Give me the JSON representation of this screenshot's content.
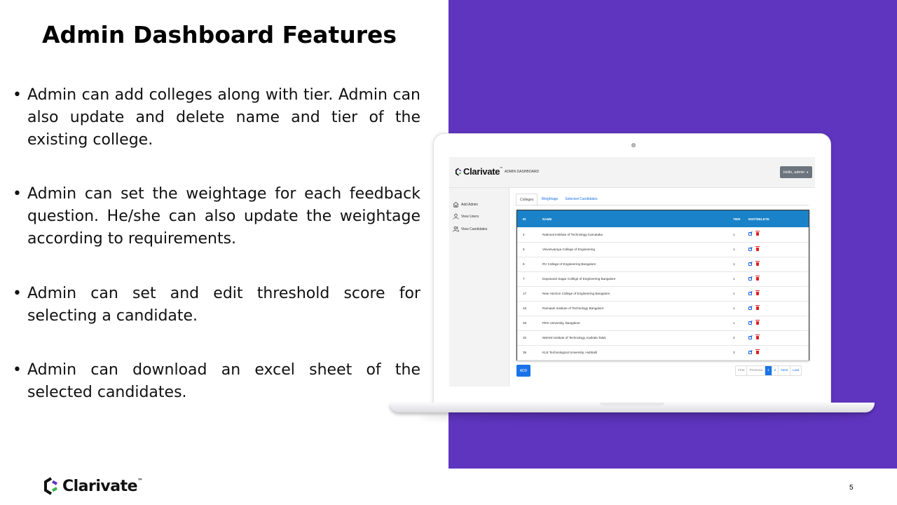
{
  "slide": {
    "title": "Admin Dashboard Features",
    "bullets": [
      "Admin can add colleges along with tier. Admin can also update and delete name and tier of the existing college.",
      "Admin can set the weightage for each feedback question. He/she can also update the weightage according to requirements.",
      "Admin can set and edit threshold score for selecting a candidate.",
      "Admin can download an excel sheet of the selected candidates."
    ],
    "page_number": "5",
    "footer_brand": "Clarivate",
    "footer_tm": "™",
    "accent_color": "#5f35c0"
  },
  "app": {
    "brand": "Clarivate",
    "brand_tm": "™",
    "nav_title": "ADMIN DASHBOARD",
    "user_button": "Hello, admin",
    "sidebar": [
      {
        "label": "Add Admin",
        "icon": "home-icon"
      },
      {
        "label": "View Users",
        "icon": "user-icon"
      },
      {
        "label": "View Candidates",
        "icon": "users-icon"
      }
    ],
    "tabs": [
      {
        "label": "Colleges",
        "active": true
      },
      {
        "label": "Weightage",
        "active": false
      },
      {
        "label": "Selected Candidates",
        "active": false
      }
    ],
    "table": {
      "headers": [
        "ID",
        "NAME",
        "TIER",
        "EDIT/DELETE"
      ],
      "rows": [
        {
          "id": "4",
          "name": "National Institute of Technology Karnataka",
          "tier": "1"
        },
        {
          "id": "5",
          "name": "Visvesvaraya College of Engineering",
          "tier": "1"
        },
        {
          "id": "6",
          "name": "RV College of Engineering Bangalore",
          "tier": "1"
        },
        {
          "id": "7",
          "name": "Dayanand Sagar College of Engineering Bangalore",
          "tier": "1"
        },
        {
          "id": "17",
          "name": "New Horizon College of Engineering Bangalore",
          "tier": "1"
        },
        {
          "id": "19",
          "name": "Ramaiah Institute of Technology Bangalore",
          "tier": "1"
        },
        {
          "id": "28",
          "name": "PES University, Bangalore",
          "tier": "1"
        },
        {
          "id": "32",
          "name": "NMAM Institute of Technology, Karkala Taluk",
          "tier": "2"
        },
        {
          "id": "35",
          "name": "KLE Technological University, Hubballi",
          "tier": "3"
        }
      ]
    },
    "add_button": "ADD",
    "pagination": {
      "first": "First",
      "previous": "Previous",
      "pages": [
        "1",
        "2"
      ],
      "current": "1",
      "next": "Next",
      "last": "Last"
    },
    "header_color": "#1a82c8",
    "primary_color": "#1a73e8"
  }
}
